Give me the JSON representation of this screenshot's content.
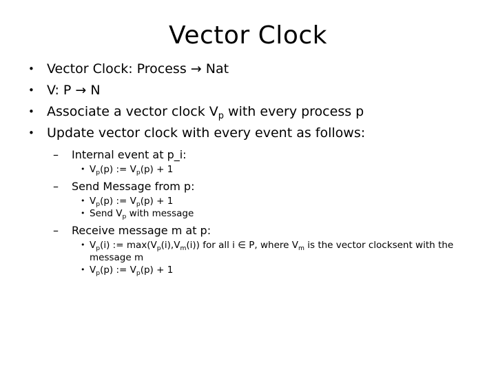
{
  "slide": {
    "title": "Vector Clock",
    "bullets_level1": [
      {
        "text_pre": "Vector Clock: Process ",
        "arrow": "→",
        "text_post": " Nat"
      },
      {
        "text_pre": "V: P ",
        "arrow": "→",
        "text_post": " N"
      }
    ],
    "bullet3": {
      "pre": "Associate a vector clock V",
      "sub": "p",
      "post": " with every process p"
    },
    "bullet4": "Update vector clock with every event as follows:",
    "bullet_glyph_level1": "•",
    "bullet_glyph_level2": "–",
    "bullet_glyph_level3": "•",
    "sections": [
      {
        "heading": "Internal event at p_i:",
        "items": [
          {
            "kind": "assign_pp"
          }
        ]
      },
      {
        "heading": "Send Message from p:",
        "items": [
          {
            "kind": "assign_pp"
          },
          {
            "kind": "send_vp"
          }
        ]
      },
      {
        "heading": "Receive message m at p:",
        "items": [
          {
            "kind": "max_rule"
          },
          {
            "kind": "assign_pp"
          }
        ]
      }
    ],
    "formula_parts": {
      "V": "V",
      "sub_p": "p",
      "sub_m": "m",
      "paren_p": "(p)",
      "paren_i": "(i)",
      "assign": " := ",
      "plus_one": " + 1",
      "max_open": "max(",
      "comma": ",",
      "close": ")",
      "send_prefix": "Send ",
      "send_suffix": " with message",
      "for_all": " for all i ",
      "elem_of": "∈",
      "in_P": " P, where ",
      "is_vector_clock": " is the vector clock",
      "wrap_line": "sent with the message m"
    }
  }
}
